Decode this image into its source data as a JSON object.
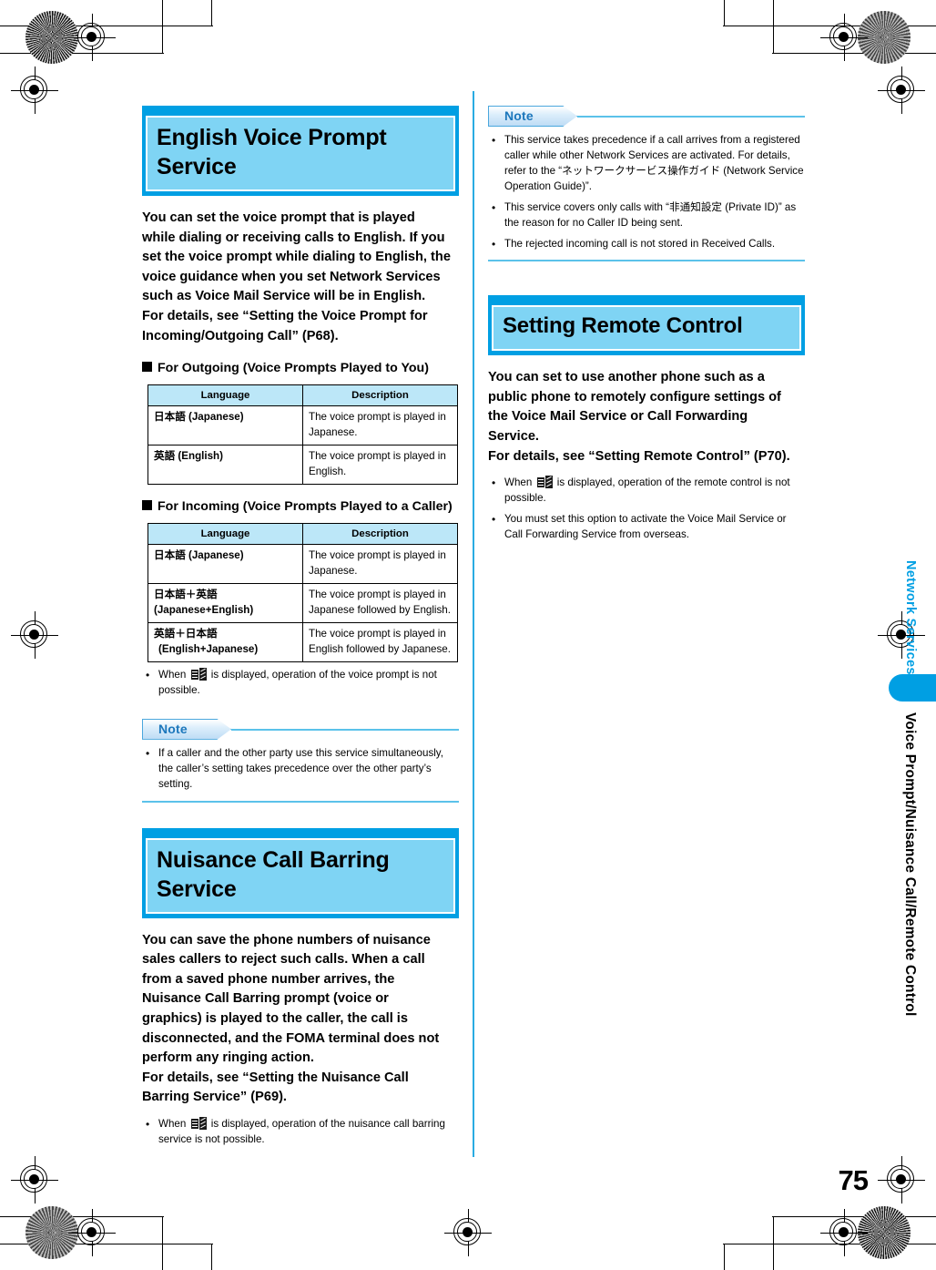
{
  "page": {
    "number": "75",
    "side_chapter": "Network Services",
    "side_section": "Voice Prompt/Nuisance Call/Remote Control",
    "accent_color": "#009FE3",
    "header_fill_color": "#7FD4F4",
    "table_header_color": "#BCE7F8",
    "note_rule_color": "#5BC2EA"
  },
  "left_column": {
    "section1": {
      "title": "English Voice Prompt Service",
      "lead_lines": [
        "You can set the voice prompt that is played",
        "while dialing or receiving calls to English. If you",
        "set the voice prompt while dialing to English, the",
        "voice guidance when you set Network Services",
        "such as Voice Mail Service will be in English.",
        "For details, see “Setting the Voice Prompt for",
        "Incoming/Outgoing Call” (P68)."
      ],
      "subhead_outgoing": "For Outgoing (Voice Prompts Played to You)",
      "table_outgoing": {
        "headers": [
          "Language",
          "Description"
        ],
        "rows": [
          {
            "lang_jp": "日本語 (Japanese)",
            "lang_sub": "",
            "desc": "The voice prompt is played in Japanese."
          },
          {
            "lang_jp": "英語 (English)",
            "lang_sub": "",
            "desc": "The voice prompt is played in English."
          }
        ]
      },
      "subhead_incoming": "For Incoming (Voice Prompts Played to a Caller)",
      "table_incoming": {
        "headers": [
          "Language",
          "Description"
        ],
        "rows": [
          {
            "lang_jp": "日本語 (Japanese)",
            "lang_sub": "",
            "desc": "The voice prompt is played in Japanese."
          },
          {
            "lang_jp": "日本語＋英語",
            "lang_sub": "(Japanese+English)",
            "desc": "The voice prompt is played in Japanese followed by English."
          },
          {
            "lang_jp": "英語＋日本語",
            "lang_sub": "(English+Japanese)",
            "desc": "The voice prompt is played in English followed by Japanese."
          }
        ]
      },
      "bullet_icon_pre": "When",
      "bullet_icon_post": "is displayed, operation of the voice prompt is not possible.",
      "note": {
        "label": "Note",
        "items": [
          "If a caller and the other party use this service simultaneously, the caller’s setting takes precedence over the other party’s setting."
        ]
      }
    },
    "section2": {
      "title": "Nuisance Call Barring Service",
      "lead_lines": [
        "You can save the phone numbers of nuisance",
        "sales callers to reject such calls. When a call",
        "from a saved phone number arrives, the",
        "Nuisance Call Barring prompt (voice or",
        "graphics) is played to the caller, the call is",
        "disconnected, and the FOMA terminal does not",
        "perform any ringing action.",
        "For details, see “Setting the Nuisance Call",
        "Barring Service” (P69)."
      ],
      "bullet_icon_pre": "When",
      "bullet_icon_post": "is displayed, operation of the nuisance call barring service is not possible."
    }
  },
  "right_column": {
    "note_top": {
      "label": "Note",
      "items": [
        "This service takes precedence if a call arrives from a registered caller while other Network Services are activated. For details, refer to the “ネットワークサービス操作ガイド (Network Service Operation Guide)”.",
        "This service covers only calls with “非通知設定 (Private ID)” as the reason for no Caller ID being sent.",
        "The rejected incoming call is not stored in Received Calls."
      ]
    },
    "section": {
      "title": "Setting Remote Control",
      "lead_lines": [
        "You can set to use another phone such as a",
        "public phone to remotely configure settings of",
        "the Voice Mail Service or Call Forwarding",
        "Service.",
        "For details, see “Setting Remote Control” (P70)."
      ],
      "bullet_icon_pre": "When",
      "bullet_icon_post": "is displayed, operation of the remote control is not possible.",
      "bullet2": "You must set this option to activate the Voice Mail Service or Call Forwarding Service from overseas."
    }
  }
}
